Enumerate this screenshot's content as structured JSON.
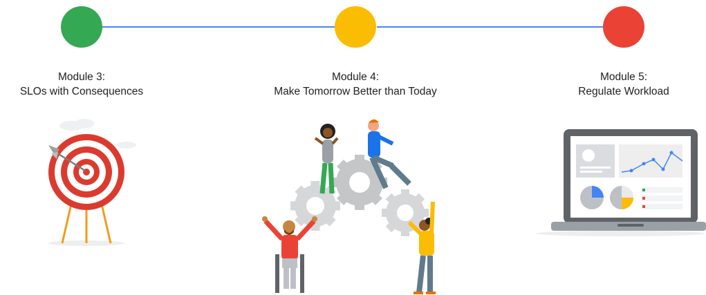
{
  "colors": {
    "connector": "#4a86e8",
    "green": "#34a853",
    "yellow": "#fbbc04",
    "red": "#ea4335"
  },
  "modules": [
    {
      "heading": "Module 3:",
      "subtitle": "SLOs with Consequences",
      "color": "#34a853",
      "illustration": "target-icon"
    },
    {
      "heading": "Module 4:",
      "subtitle": "Make Tomorrow Better than Today",
      "color": "#fbbc04",
      "illustration": "team-gears-icon"
    },
    {
      "heading": "Module 5:",
      "subtitle": "Regulate Workload",
      "color": "#ea4335",
      "illustration": "laptop-dashboard-icon"
    }
  ]
}
